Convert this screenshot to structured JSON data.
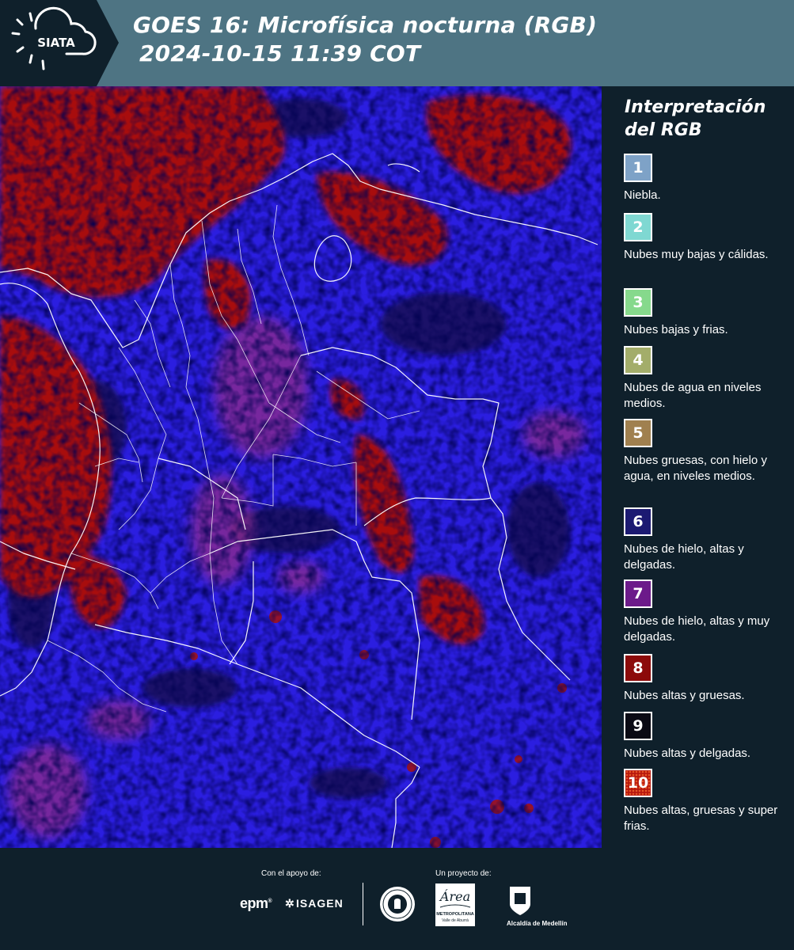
{
  "header": {
    "logo_text": "SIATA",
    "title_line1": "GOES 16: Microfísica nocturna (RGB)",
    "title_line2": "2024-10-15 11:39 COT"
  },
  "legend": {
    "title": "Interpretación del RGB",
    "items": [
      {
        "number": "1",
        "label": "Niebla.",
        "color": "#7ea2c7"
      },
      {
        "number": "2",
        "label": "Nubes muy bajas y cálidas.",
        "color": "#7fd8d2"
      },
      {
        "number": "3",
        "label": "Nubes bajas y frias.",
        "color": "#86d98c"
      },
      {
        "number": "4",
        "label": "Nubes de agua en niveles medios.",
        "color": "#a3ad6a"
      },
      {
        "number": "5",
        "label": "Nubes gruesas, con hielo y agua, en niveles medios.",
        "color": "#a0804f"
      },
      {
        "number": "6",
        "label": "Nubes de hielo, altas y delgadas.",
        "color": "#1c1a72"
      },
      {
        "number": "7",
        "label": "Nubes de hielo, altas y muy delgadas.",
        "color": "#6c1a8a"
      },
      {
        "number": "8",
        "label": "Nubes altas y gruesas.",
        "color": "#8c0a0a"
      },
      {
        "number": "9",
        "label": "Nubes altas y delgadas.",
        "color": "#0a0a14"
      },
      {
        "number": "10",
        "label": "Nubes altas, gruesas y super frias.",
        "color": "#b8180e"
      }
    ]
  },
  "footer": {
    "support_label": "Con el apoyo de:",
    "project_label": "Un proyecto de:",
    "epm": "epm",
    "isagen": "ISAGEN",
    "area_text1": "METROPOLITANA",
    "area_text2": "Valle de Aburrá",
    "alcaldia": "Alcaldía de Medellín"
  },
  "colors": {
    "header_bg": "#4e7483",
    "panel_bg": "#0f202b",
    "map_blue": "#2b1ee0",
    "map_red": "#a8100c",
    "map_magenta": "#8a2a8e"
  }
}
